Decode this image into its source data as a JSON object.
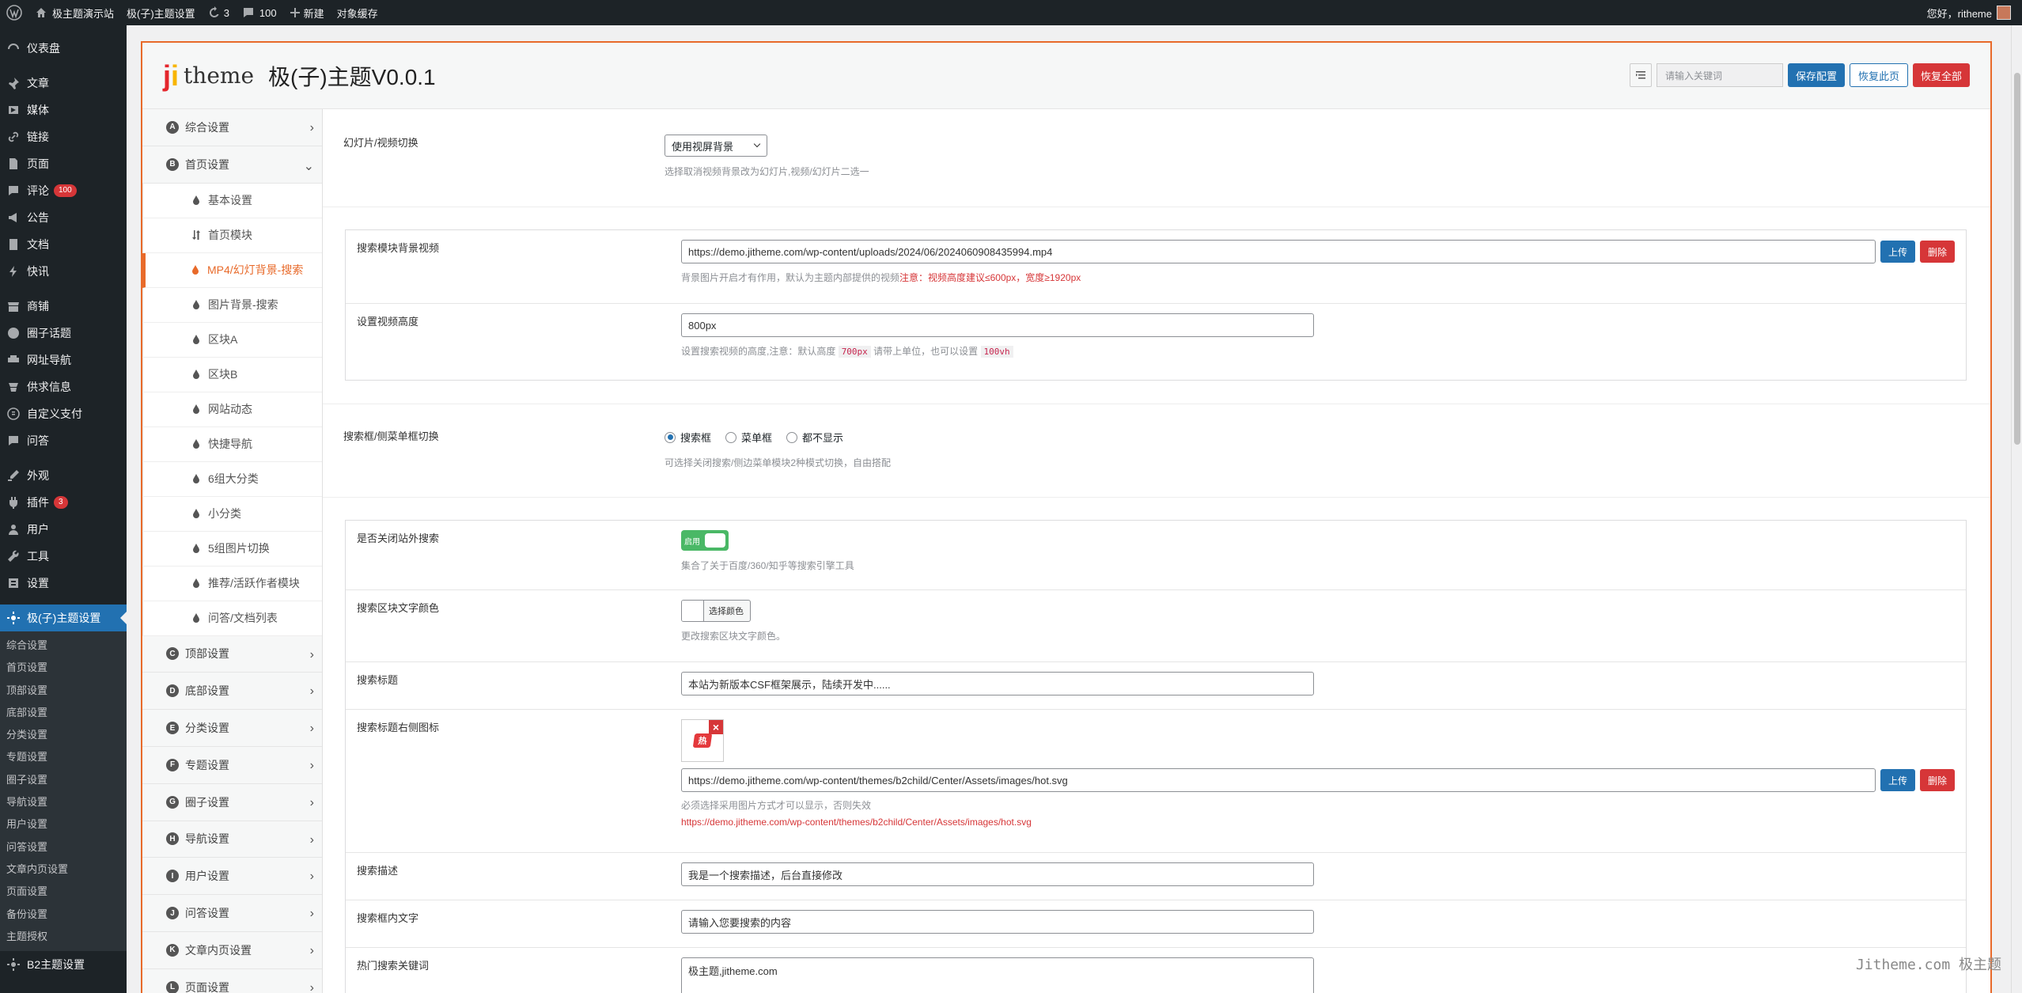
{
  "adminbar": {
    "site_name": "极主题演示站",
    "theme_settings": "极(子)主题设置",
    "updates_count": "3",
    "comments_count": "100",
    "new_label": "新建",
    "cache_label": "对象缓存",
    "greeting": "您好，ritheme"
  },
  "menu": {
    "items": [
      {
        "label": "仪表盘",
        "icon": "dashboard-icon"
      },
      {
        "label": "文章",
        "icon": "pin-icon"
      },
      {
        "label": "媒体",
        "icon": "media-icon"
      },
      {
        "label": "链接",
        "icon": "link-icon"
      },
      {
        "label": "页面",
        "icon": "page-icon"
      },
      {
        "label": "评论",
        "icon": "comment-icon",
        "badge": "100"
      },
      {
        "label": "公告",
        "icon": "megaphone-icon"
      },
      {
        "label": "文档",
        "icon": "document-icon"
      },
      {
        "label": "快讯",
        "icon": "flash-icon"
      },
      {
        "label": "商铺",
        "icon": "store-icon"
      },
      {
        "label": "圈子话题",
        "icon": "circle-icon"
      },
      {
        "label": "网址导航",
        "icon": "navigation-icon"
      },
      {
        "label": "供求信息",
        "icon": "supply-icon"
      },
      {
        "label": "自定义支付",
        "icon": "pay-icon"
      },
      {
        "label": "问答",
        "icon": "qa-icon"
      },
      {
        "label": "外观",
        "icon": "appearance-icon"
      },
      {
        "label": "插件",
        "icon": "plugin-icon",
        "badge": "3"
      },
      {
        "label": "用户",
        "icon": "user-icon"
      },
      {
        "label": "工具",
        "icon": "tool-icon"
      },
      {
        "label": "设置",
        "icon": "settings-icon"
      }
    ],
    "current": "极(子)主题设置",
    "submenu": [
      "综合设置",
      "首页设置",
      "顶部设置",
      "底部设置",
      "分类设置",
      "专题设置",
      "圈子设置",
      "导航设置",
      "用户设置",
      "问答设置",
      "文章内页设置",
      "页面设置",
      "备份设置",
      "主题授权"
    ],
    "b2": "B2主题设置"
  },
  "header": {
    "logo_j": "j",
    "logo_i": "i",
    "logo_text": "theme",
    "title": "极(子)主题V0.0.1",
    "search_placeholder": "请输入关键词",
    "save_label": "保存配置",
    "reset_page_label": "恢复此页",
    "reset_all_label": "恢复全部"
  },
  "nav": {
    "top": [
      {
        "letter": "A",
        "label": "综合设置"
      },
      {
        "letter": "B",
        "label": "首页设置"
      }
    ],
    "sub": [
      "基本设置",
      "首页模块",
      "MP4/幻灯背景-搜索",
      "图片背景-搜索",
      "区块A",
      "区块B",
      "网站动态",
      "快捷导航",
      "6组大分类",
      "小分类",
      "5组图片切换",
      "推荐/活跃作者模块",
      "问答/文档列表"
    ],
    "active_sub": "MP4/幻灯背景-搜索",
    "bottom": [
      {
        "letter": "C",
        "label": "顶部设置"
      },
      {
        "letter": "D",
        "label": "底部设置"
      },
      {
        "letter": "E",
        "label": "分类设置"
      },
      {
        "letter": "F",
        "label": "专题设置"
      },
      {
        "letter": "G",
        "label": "圈子设置"
      },
      {
        "letter": "H",
        "label": "导航设置"
      },
      {
        "letter": "I",
        "label": "用户设置"
      },
      {
        "letter": "J",
        "label": "问答设置"
      },
      {
        "letter": "K",
        "label": "文章内页设置"
      },
      {
        "letter": "L",
        "label": "页面设置"
      }
    ]
  },
  "form": {
    "slide_label": "幻灯片/视频切换",
    "slide_value": "使用视屏背景",
    "slide_desc": "选择取消视频背景改为幻灯片,视频/幻灯片二选一",
    "video_label": "搜索模块背景视频",
    "video_url": "https://demo.jitheme.com/wp-content/uploads/2024/06/2024060908435994.mp4",
    "upload_label": "上传",
    "delete_label": "删除",
    "video_desc": "背景图片开启才有作用，默认为主题内部提供的视频",
    "video_desc_red": "注意：视频高度建议≤600px，宽度≥1920px",
    "height_label": "设置视频高度",
    "height_value": "800px",
    "height_desc_1": "设置搜索视频的高度,注意：默认高度",
    "height_code_1": "700px",
    "height_desc_2": "请带上单位，也可以设置",
    "height_code_2": "100vh",
    "toggle_label": "搜索框/侧菜单框切换",
    "radio_1": "搜索框",
    "radio_2": "菜单框",
    "radio_3": "都不显示",
    "toggle_desc": "可选择关闭搜索/侧边菜单模块2种模式切换，自由搭配",
    "external_label": "是否关闭站外搜索",
    "switch_text": "启用",
    "external_desc": "集合了关于百度/360/知乎等搜索引擎工具",
    "color_label": "搜索区块文字颜色",
    "color_button": "选择颜色",
    "color_desc": "更改搜索区块文字颜色。",
    "search_title_label": "搜索标题",
    "search_title_value": "本站为新版本CSF框架展示，陆续开发中......",
    "icon_label": "搜索标题右侧图标",
    "icon_thumb_text": "热",
    "icon_url": "https://demo.jitheme.com/wp-content/themes/b2child/Center/Assets/images/hot.svg",
    "icon_desc": "必须选择采用图片方式才可以显示，否则失效",
    "icon_desc_red": "https://demo.jitheme.com/wp-content/themes/b2child/Center/Assets/images/hot.svg",
    "desc_label": "搜索描述",
    "desc_value": "我是一个搜索描述，后台直接修改",
    "inner_label": "搜索框内文字",
    "inner_value": "请输入您要搜索的内容",
    "hot_label": "热门搜索关键词",
    "hot_value": "极主题,jitheme.com"
  },
  "watermark": "Jitheme.com 极主题",
  "colors": {
    "accent": "#e86a2a",
    "primary": "#2271b1",
    "danger": "#d63638",
    "success": "#4ab866"
  }
}
